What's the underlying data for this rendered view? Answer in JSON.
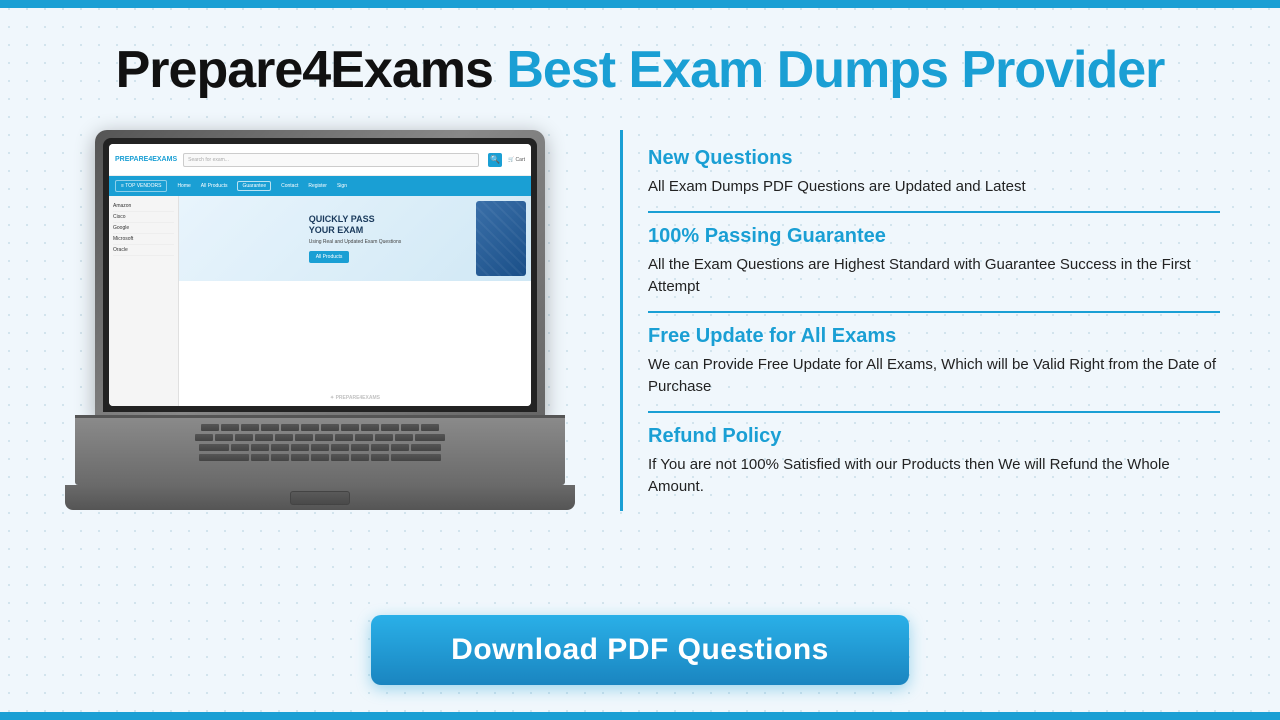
{
  "topBar": {},
  "header": {
    "brand": "Prepare4Exams",
    "tagline": " Best Exam Dumps Provider"
  },
  "features": [
    {
      "title": "New Questions",
      "description": "All Exam Dumps PDF Questions are Updated and Latest"
    },
    {
      "title": "100% Passing Guarantee",
      "description": "All the Exam Questions are Highest Standard with Guarantee Success in the First Attempt"
    },
    {
      "title": "Free Update for All Exams",
      "description": "We can Provide Free Update for All Exams, Which will be Valid Right from the Date of Purchase"
    },
    {
      "title": "Refund Policy",
      "description": "If You are not 100% Satisfied with our Products then We will Refund the Whole Amount."
    }
  ],
  "laptop": {
    "screen": {
      "logo": "PREPARE4EXAMS",
      "searchPlaceholder": "Search for exam...",
      "navItems": [
        "Home",
        "All Products",
        "Guarantee",
        "Contact",
        "Register",
        "Sign"
      ],
      "menuLabel": "≡  TOP VENDORS",
      "sidebarItems": [
        "Amazon",
        "Cisco",
        "Google",
        "Microsoft",
        "Oracle"
      ],
      "heroTitle": "QUICKLY PASS YOUR EXAM",
      "heroSub": "Using Real and Updated Exam Questions",
      "heroBtn": "All Products",
      "watermark": "PREPARE4EXAMS"
    }
  },
  "downloadButton": {
    "label": "Download PDF Questions"
  }
}
